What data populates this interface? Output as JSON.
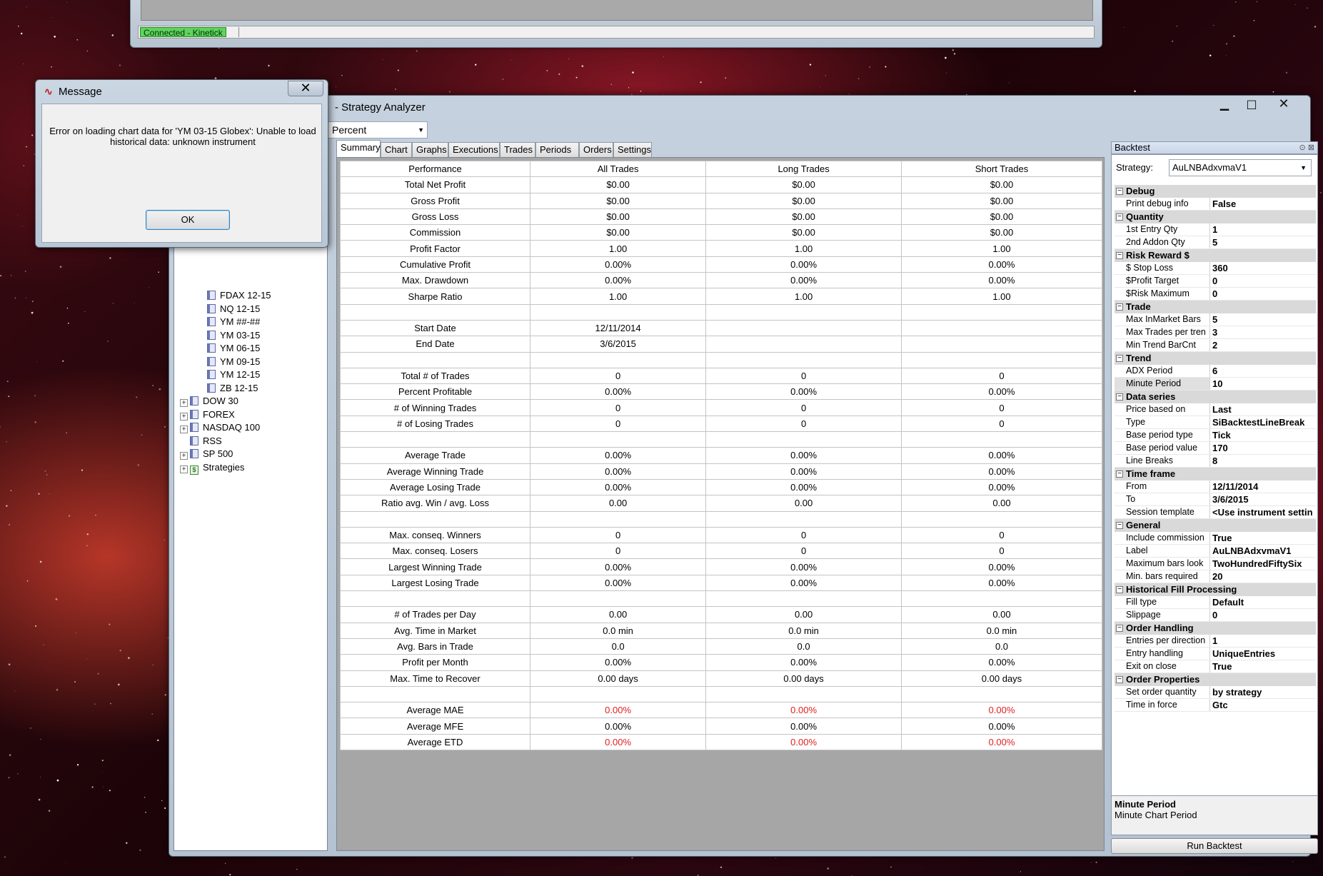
{
  "top_window": {
    "connection_status": "Connected - Kinetick",
    "status_color": "#5fd35f"
  },
  "main_window": {
    "title": "- Strategy Analyzer",
    "controls": {
      "minimize": "▁",
      "maximize": "□",
      "close": "✕"
    },
    "display_unit": "Percent",
    "tabs": [
      "Summary",
      "Chart",
      "Graphs",
      "Executions",
      "Trades",
      "Periods",
      "Orders",
      "Settings"
    ],
    "active_tab": "Summary"
  },
  "tree": {
    "items": [
      {
        "label": "FDAX 12-15",
        "type": "instrument"
      },
      {
        "label": "NQ 12-15",
        "type": "instrument"
      },
      {
        "label": "YM ##-##",
        "type": "instrument"
      },
      {
        "label": "YM 03-15",
        "type": "instrument"
      },
      {
        "label": "YM 06-15",
        "type": "instrument"
      },
      {
        "label": "YM 09-15",
        "type": "instrument"
      },
      {
        "label": "YM 12-15",
        "type": "instrument"
      },
      {
        "label": "ZB 12-15",
        "type": "instrument"
      },
      {
        "label": "DOW 30",
        "type": "list",
        "expander": "+"
      },
      {
        "label": "FOREX",
        "type": "list",
        "expander": "+"
      },
      {
        "label": "NASDAQ 100",
        "type": "list",
        "expander": "+"
      },
      {
        "label": "RSS",
        "type": "list"
      },
      {
        "label": "SP 500",
        "type": "list",
        "expander": "+"
      },
      {
        "label": "Strategies",
        "type": "strategies",
        "expander": "+"
      }
    ]
  },
  "summary": {
    "headers": [
      "Performance",
      "All Trades",
      "Long Trades",
      "Short Trades"
    ],
    "rows": [
      {
        "label": "Total Net Profit",
        "values": [
          "$0.00",
          "$0.00",
          "$0.00"
        ]
      },
      {
        "label": "Gross Profit",
        "values": [
          "$0.00",
          "$0.00",
          "$0.00"
        ]
      },
      {
        "label": "Gross Loss",
        "values": [
          "$0.00",
          "$0.00",
          "$0.00"
        ]
      },
      {
        "label": "Commission",
        "values": [
          "$0.00",
          "$0.00",
          "$0.00"
        ]
      },
      {
        "label": "Profit Factor",
        "values": [
          "1.00",
          "1.00",
          "1.00"
        ]
      },
      {
        "label": "Cumulative Profit",
        "values": [
          "0.00%",
          "0.00%",
          "0.00%"
        ]
      },
      {
        "label": "Max. Drawdown",
        "values": [
          "0.00%",
          "0.00%",
          "0.00%"
        ]
      },
      {
        "label": "Sharpe Ratio",
        "values": [
          "1.00",
          "1.00",
          "1.00"
        ]
      },
      {
        "label": "",
        "values": [
          "",
          "",
          ""
        ]
      },
      {
        "label": "Start Date",
        "values": [
          "12/11/2014",
          "",
          ""
        ]
      },
      {
        "label": "End Date",
        "values": [
          "3/6/2015",
          "",
          ""
        ]
      },
      {
        "label": "",
        "values": [
          "",
          "",
          ""
        ]
      },
      {
        "label": "Total # of Trades",
        "values": [
          "0",
          "0",
          "0"
        ]
      },
      {
        "label": "Percent Profitable",
        "values": [
          "0.00%",
          "0.00%",
          "0.00%"
        ]
      },
      {
        "label": "# of Winning Trades",
        "values": [
          "0",
          "0",
          "0"
        ]
      },
      {
        "label": "# of Losing Trades",
        "values": [
          "0",
          "0",
          "0"
        ]
      },
      {
        "label": "",
        "values": [
          "",
          "",
          ""
        ]
      },
      {
        "label": "Average Trade",
        "values": [
          "0.00%",
          "0.00%",
          "0.00%"
        ]
      },
      {
        "label": "Average Winning Trade",
        "values": [
          "0.00%",
          "0.00%",
          "0.00%"
        ]
      },
      {
        "label": "Average Losing Trade",
        "values": [
          "0.00%",
          "0.00%",
          "0.00%"
        ]
      },
      {
        "label": "Ratio avg. Win / avg. Loss",
        "values": [
          "0.00",
          "0.00",
          "0.00"
        ]
      },
      {
        "label": "",
        "values": [
          "",
          "",
          ""
        ]
      },
      {
        "label": "Max. conseq. Winners",
        "values": [
          "0",
          "0",
          "0"
        ]
      },
      {
        "label": "Max. conseq. Losers",
        "values": [
          "0",
          "0",
          "0"
        ]
      },
      {
        "label": "Largest Winning Trade",
        "values": [
          "0.00%",
          "0.00%",
          "0.00%"
        ]
      },
      {
        "label": "Largest Losing Trade",
        "values": [
          "0.00%",
          "0.00%",
          "0.00%"
        ]
      },
      {
        "label": "",
        "values": [
          "",
          "",
          ""
        ]
      },
      {
        "label": "# of Trades per Day",
        "values": [
          "0.00",
          "0.00",
          "0.00"
        ]
      },
      {
        "label": "Avg. Time in Market",
        "values": [
          "0.0 min",
          "0.0 min",
          "0.0 min"
        ]
      },
      {
        "label": "Avg. Bars in Trade",
        "values": [
          "0.0",
          "0.0",
          "0.0"
        ]
      },
      {
        "label": "Profit per Month",
        "values": [
          "0.00%",
          "0.00%",
          "0.00%"
        ]
      },
      {
        "label": "Max. Time to Recover",
        "values": [
          "0.00 days",
          "0.00 days",
          "0.00 days"
        ]
      },
      {
        "label": "",
        "values": [
          "",
          "",
          ""
        ]
      },
      {
        "label": "Average MAE",
        "values": [
          "0.00%",
          "0.00%",
          "0.00%"
        ],
        "red": true
      },
      {
        "label": "Average MFE",
        "values": [
          "0.00%",
          "0.00%",
          "0.00%"
        ]
      },
      {
        "label": "Average ETD",
        "values": [
          "0.00%",
          "0.00%",
          "0.00%"
        ],
        "red": true
      }
    ],
    "negative_color": "#e02020"
  },
  "properties": {
    "panel_title": "Backtest",
    "strategy_label": "Strategy:",
    "strategy_value": "AuLNBAdxvmaV1",
    "categories": [
      {
        "name": "Debug",
        "props": [
          {
            "name": "Print debug info",
            "value": "False"
          }
        ]
      },
      {
        "name": "Quantity",
        "props": [
          {
            "name": "1st Entry Qty",
            "value": "1"
          },
          {
            "name": "2nd Addon Qty",
            "value": "5"
          }
        ]
      },
      {
        "name": "Risk Reward $",
        "props": [
          {
            "name": "$ Stop Loss",
            "value": "360"
          },
          {
            "name": "$Profit Target",
            "value": "0"
          },
          {
            "name": "$Risk Maximum",
            "value": "0"
          }
        ]
      },
      {
        "name": "Trade",
        "props": [
          {
            "name": "Max InMarket Bars",
            "value": "5"
          },
          {
            "name": "Max Trades per tren",
            "value": "3"
          },
          {
            "name": "Min Trend BarCnt",
            "value": "2"
          }
        ]
      },
      {
        "name": "Trend",
        "props": [
          {
            "name": "ADX Period",
            "value": "6"
          },
          {
            "name": "Minute Period",
            "value": "10",
            "selected": true
          }
        ]
      },
      {
        "name": "Data series",
        "props": [
          {
            "name": "Price based on",
            "value": "Last"
          },
          {
            "name": "Type",
            "value": "SiBacktestLineBreak"
          },
          {
            "name": "Base period type",
            "value": "Tick"
          },
          {
            "name": "Base period value",
            "value": "170"
          },
          {
            "name": "Line Breaks",
            "value": "8"
          }
        ]
      },
      {
        "name": "Time frame",
        "props": [
          {
            "name": "From",
            "value": "12/11/2014"
          },
          {
            "name": "To",
            "value": "3/6/2015"
          },
          {
            "name": "Session template",
            "value": "<Use instrument settin"
          }
        ]
      },
      {
        "name": "General",
        "props": [
          {
            "name": "Include commission",
            "value": "True"
          },
          {
            "name": "Label",
            "value": "AuLNBAdxvmaV1"
          },
          {
            "name": "Maximum bars look",
            "value": "TwoHundredFiftySix"
          },
          {
            "name": "Min. bars required",
            "value": "20"
          }
        ]
      },
      {
        "name": "Historical Fill Processing",
        "props": [
          {
            "name": "Fill type",
            "value": "Default"
          },
          {
            "name": "Slippage",
            "value": "0"
          }
        ]
      },
      {
        "name": "Order Handling",
        "props": [
          {
            "name": "Entries per direction",
            "value": "1"
          },
          {
            "name": "Entry handling",
            "value": "UniqueEntries"
          },
          {
            "name": "Exit on close",
            "value": "True"
          }
        ]
      },
      {
        "name": "Order Properties",
        "props": [
          {
            "name": "Set order quantity",
            "value": "by strategy"
          },
          {
            "name": "Time in force",
            "value": "Gtc"
          }
        ]
      }
    ],
    "description_title": "Minute Period",
    "description_text": "Minute Chart Period",
    "run_button": "Run Backtest"
  },
  "message_dialog": {
    "title": "Message",
    "text": "Error on loading chart data for 'YM 03-15 Globex': Unable to load historical data: unknown instrument",
    "ok_label": "OK",
    "close_glyph": "✕"
  }
}
